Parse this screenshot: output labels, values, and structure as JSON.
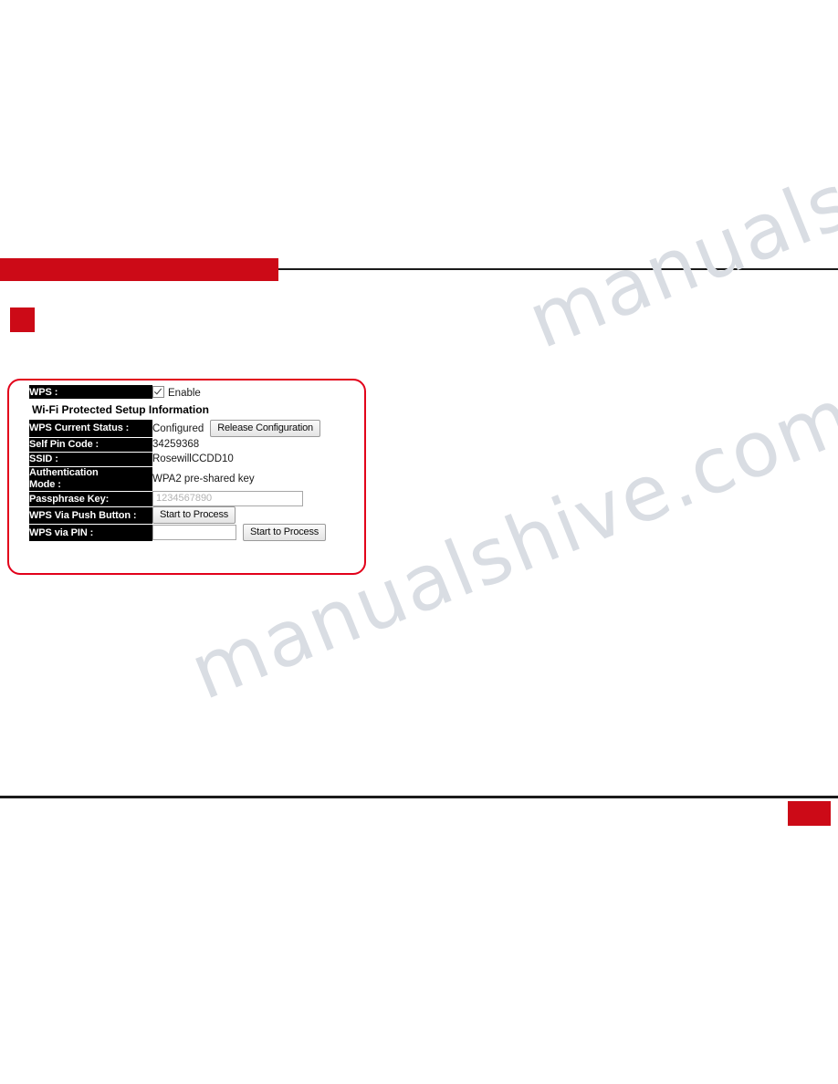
{
  "page": {
    "watermark_line1": "manualshive.com",
    "watermark_line2": "manualshive.com"
  },
  "wps_panel": {
    "rows": [
      {
        "label": "WPS :",
        "type": "checkbox",
        "checkbox_checked": true,
        "checkbox_label": "Enable"
      },
      {
        "label": "Wi-Fi Protected Setup Information",
        "type": "section"
      },
      {
        "label": "WPS Current Status :",
        "type": "value_button",
        "value": "Configured",
        "button": "Release Configuration"
      },
      {
        "label": "Self Pin Code :",
        "type": "value",
        "value": "34259368"
      },
      {
        "label": "SSID :",
        "type": "value",
        "value": "RosewillCCDD10"
      },
      {
        "label": "Authentication Mode :",
        "type": "value",
        "value": "WPA2 pre-shared key"
      },
      {
        "label": "Passphrase Key:",
        "type": "input",
        "input_value": "1234567890"
      },
      {
        "label": "WPS Via Push Button :",
        "type": "button",
        "button": "Start to Process"
      },
      {
        "label": "WPS via PIN :",
        "type": "input_button",
        "input_value": "",
        "button": "Start to Process"
      }
    ],
    "labels": {
      "wps": "WPS :",
      "section_title": "Wi-Fi Protected Setup Information",
      "current_status": "WPS Current Status :",
      "self_pin_code": "Self Pin Code :",
      "ssid": "SSID :",
      "auth_mode_line1": "Authentication",
      "auth_mode_line2": "Mode :",
      "passphrase_key": "Passphrase Key:",
      "push_button": "WPS Via Push Button :",
      "via_pin": "WPS via PIN :"
    },
    "values": {
      "enable": "Enable",
      "current_status": "Configured",
      "release_configuration": "Release Configuration",
      "self_pin_code": "34259368",
      "ssid": "RosewillCCDD10",
      "auth_mode": "WPA2 pre-shared key",
      "passphrase_placeholder": "1234567890",
      "pin_value": "",
      "start_to_process_push": "Start to Process",
      "start_to_process_pin": "Start to Process"
    }
  },
  "colors": {
    "brand_red": "#cc0a17",
    "callout_red": "#e2001a",
    "label_bg": "#000000",
    "rule": "#1a1a1a"
  }
}
